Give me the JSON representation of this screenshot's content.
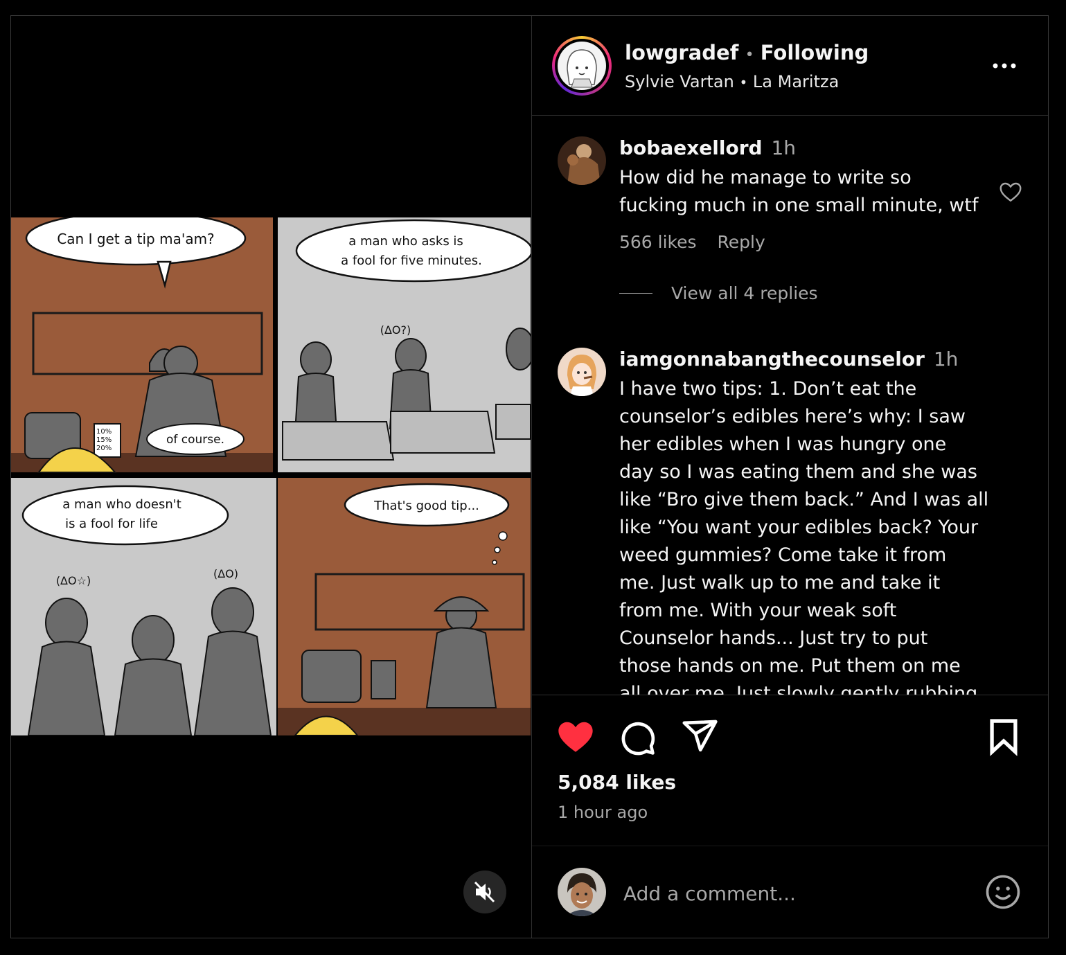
{
  "post": {
    "username": "lowgradef",
    "dot": "•",
    "follow_status": "Following",
    "audio_artist": "Sylvie Vartan",
    "audio_title": "La Maritza",
    "more_icon": "ellipsis-icon"
  },
  "comic": {
    "panel1_bubble": "Can I get a tip ma'am?",
    "panel1_screen": [
      "10%",
      "15%",
      "20%"
    ],
    "panel1_reply": "of course.",
    "panel2_bubble_line1": "a man who asks is",
    "panel2_bubble_line2": "a fool for five minutes.",
    "panel2_thought": "(ΔO?)",
    "panel3_bubble_line1": "a man who doesn't",
    "panel3_bubble_line2": "is a fool for life",
    "panel3_thought_left": "(ΔO☆)",
    "panel3_thought_right": "(ΔO)",
    "panel4_bubble": "That's good tip...",
    "colors": {
      "brown": "#9a5b3a",
      "gray": "#c9c9c9",
      "figure": "#6b6b6b",
      "chick": "#f4d24a"
    }
  },
  "mute_icon": "speaker-muted-icon",
  "comments": [
    {
      "username": "bobaexellord",
      "time": "1h",
      "text_lines": [
        "How did he manage to write so",
        "fucking much in one small minute, wtf"
      ],
      "likes": "566 likes",
      "reply": "Reply",
      "view_replies": "View all 4 replies"
    },
    {
      "username": "iamgonnabangthecounselor",
      "time": "1h",
      "text_lines": [
        "I have two tips: 1. Don’t eat the",
        "counselor’s edibles here’s why: I saw",
        "her edibles when I was hungry one",
        "day so I was eating them and she was",
        "like “Bro give them back.” And I was all",
        "like “You want your edibles back? Your",
        "weed gummies? Come take it from",
        "me. Just walk up to me and take it",
        "from me. With your weak soft",
        "Counselor hands... Just try to put",
        "those hands on me. Put them on me",
        "all over me. Just slowly gently rubbing"
      ]
    }
  ],
  "actions": {
    "like_icon": "heart-filled-icon",
    "comment_icon": "comment-icon",
    "share_icon": "paper-plane-icon",
    "save_icon": "bookmark-icon",
    "likes": "5,084 likes",
    "time_ago": "1 hour ago",
    "like_color": "#ff3040"
  },
  "add_comment": {
    "placeholder": "Add a comment...",
    "emoji_icon": "emoji-icon"
  }
}
